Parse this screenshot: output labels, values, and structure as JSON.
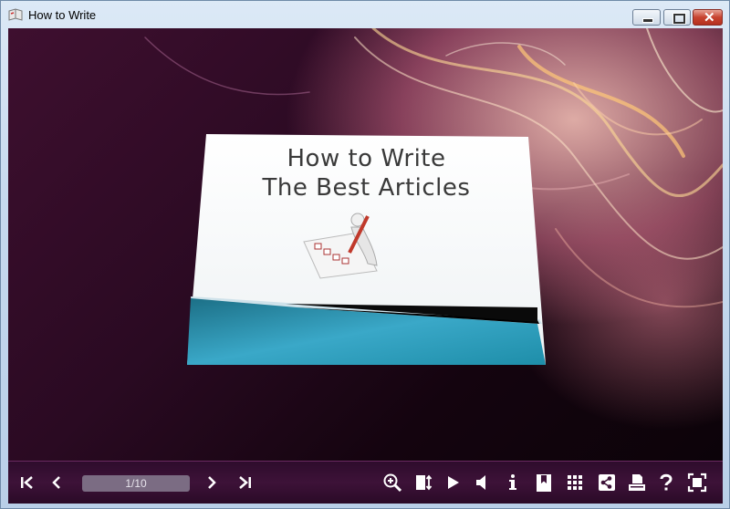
{
  "window": {
    "title": "How to Write"
  },
  "book": {
    "title_line1": "How to Write",
    "title_line2": "The Best Articles"
  },
  "toolbar": {
    "page_indicator": "1/10",
    "icons": [
      "first-page-icon",
      "previous-page-icon",
      "next-page-icon",
      "last-page-icon",
      "zoom-in-icon",
      "fit-page-icon",
      "autoplay-icon",
      "sound-icon",
      "info-icon",
      "bookmark-icon",
      "thumbnails-icon",
      "share-icon",
      "print-icon",
      "help-icon",
      "fullscreen-icon"
    ]
  },
  "colors": {
    "toolbar_bg": "#3d1238",
    "teal_band": "#1f8fae"
  }
}
